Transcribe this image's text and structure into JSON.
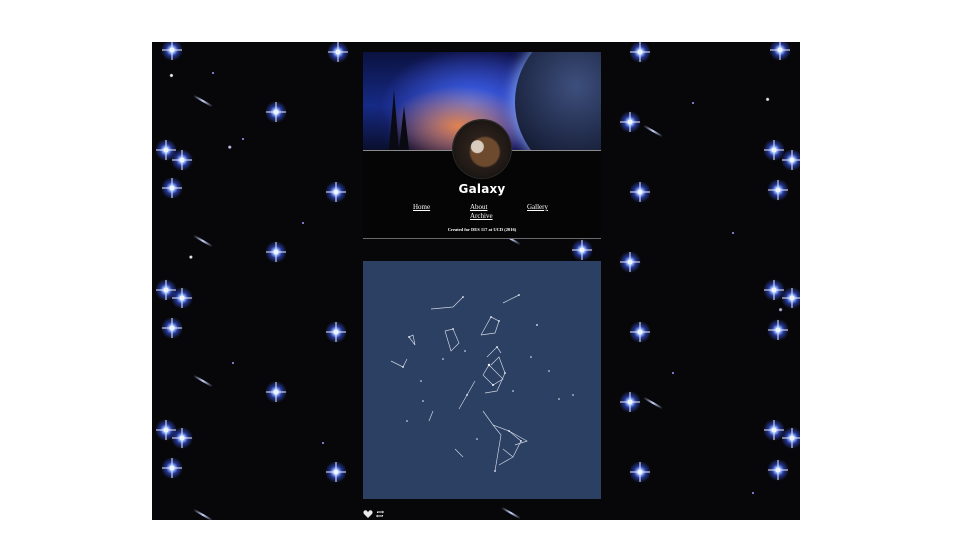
{
  "blog": {
    "title": "Galaxy",
    "credit": "Created for DES 117 at UCD (2016)"
  },
  "nav": {
    "items": [
      {
        "label": "Home"
      },
      {
        "label": "About"
      },
      {
        "label": "Archive"
      },
      {
        "label": "Gallery"
      }
    ]
  },
  "post": {
    "background_color": "#2b4063",
    "image_subject": "constellation-network-artwork"
  },
  "actions": {
    "like_icon": "heart-icon",
    "reblog_icon": "reblog-icon"
  },
  "colors": {
    "page_background": "#070709",
    "star_glow": "#8fb2ff",
    "panel_background": "#050505",
    "text": "#ffffff"
  }
}
